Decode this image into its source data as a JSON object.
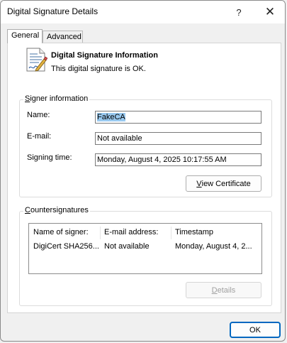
{
  "window": {
    "title": "Digital Signature Details",
    "help_glyph": "?",
    "close_glyph": "✕"
  },
  "tabs": [
    {
      "label": "General",
      "selected": true
    },
    {
      "label": "Advanced",
      "selected": false
    }
  ],
  "info": {
    "title": "Digital Signature Information",
    "status": "This digital signature is OK."
  },
  "signer": {
    "group_label_first": "S",
    "group_label_rest": "igner information",
    "fields": [
      {
        "label": "Name:",
        "value": "FakeCA",
        "selected": true
      },
      {
        "label": "E-mail:",
        "value": "Not available"
      },
      {
        "label": "Signing time:",
        "value": "Monday, August 4, 2025 10:17:55 AM"
      }
    ],
    "view_cert_first": "V",
    "view_cert_rest": "iew Certificate"
  },
  "countersignatures": {
    "group_label_first": "C",
    "group_label_rest": "ountersignatures",
    "columns": [
      "Name of signer:",
      "E-mail address:",
      "Timestamp"
    ],
    "rows": [
      [
        "DigiCert SHA256...",
        "Not available",
        "Monday, August 4, 2..."
      ]
    ],
    "details_first": "D",
    "details_rest": "etails"
  },
  "footer": {
    "ok_label": "OK"
  },
  "colors": {
    "accent": "#0067c0",
    "selection": "#99c9ef"
  }
}
